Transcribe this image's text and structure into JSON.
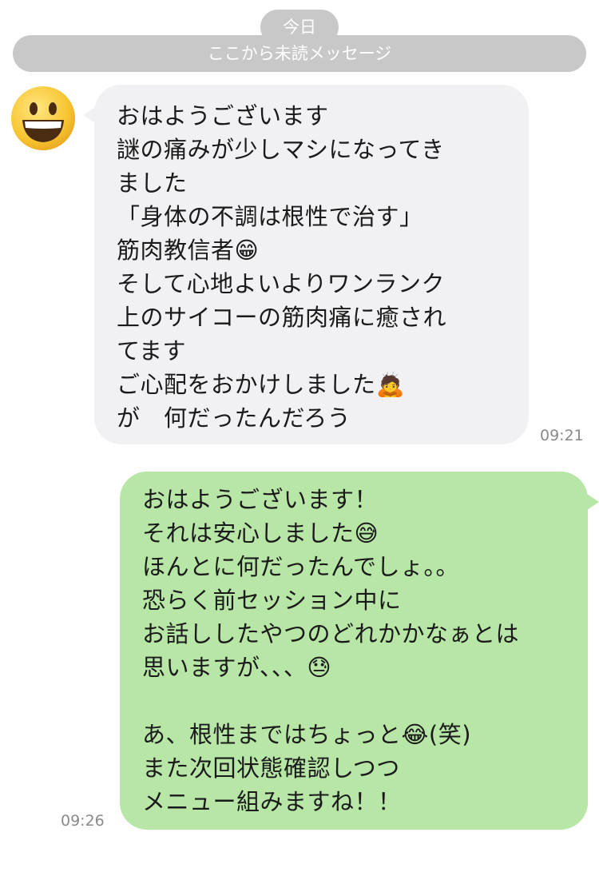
{
  "header": {
    "date_label": "今日",
    "unread_divider": "ここから未読メッセージ"
  },
  "messages": [
    {
      "direction": "incoming",
      "avatar_icon": "grinning-face-icon",
      "text": "おはようございます\n謎の痛みが少しマシになってき\nました\n「身体の不調は根性で治す」\n筋肉教信者😁\nそして心地よいよりワンランク\n上のサイコーの筋肉痛に癒され\nてます\nご心配をおかけしました🙇\nが　何だったんだろう",
      "time": "09:21"
    },
    {
      "direction": "outgoing",
      "text": "おはようございます！\nそれは安心しました😅\nほんとに何だったんでしょ。。\n恐らく前セッション中に\nお話ししたやつのどれかかなぁとは\n思いますが、、、😓\n\nあ、根性まではちょっと😂(笑)\nまた次回状態確認しつつ\nメニュー組みますね！！",
      "time": "09:26"
    }
  ],
  "colors": {
    "incoming_bubble": "#f1f1f3",
    "outgoing_bubble": "#b8e6a7",
    "pill": "#c8c8c8"
  }
}
